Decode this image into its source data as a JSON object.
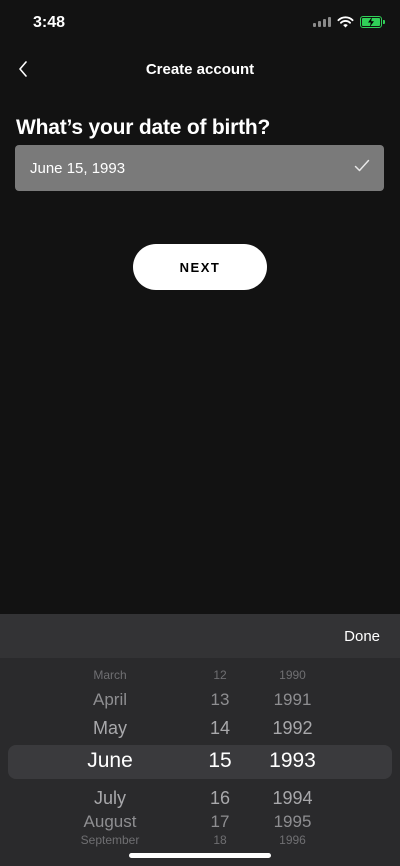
{
  "status_bar": {
    "time": "3:48"
  },
  "nav": {
    "title": "Create account"
  },
  "form": {
    "question": "What’s your date of birth?",
    "date_value": "June 15, 1993",
    "next_label": "NEXT"
  },
  "picker": {
    "done_label": "Done",
    "rows": [
      {
        "month": "March",
        "day": "12",
        "year": "1990"
      },
      {
        "month": "April",
        "day": "13",
        "year": "1991"
      },
      {
        "month": "May",
        "day": "14",
        "year": "1992"
      },
      {
        "month": "June",
        "day": "15",
        "year": "1993"
      },
      {
        "month": "July",
        "day": "16",
        "year": "1994"
      },
      {
        "month": "August",
        "day": "17",
        "year": "1995"
      },
      {
        "month": "September",
        "day": "18",
        "year": "1996"
      }
    ]
  },
  "colors": {
    "background": "#121212",
    "accent_green": "#30d158",
    "field_bg": "#7a7a7a",
    "button_bg": "#ffffff"
  }
}
